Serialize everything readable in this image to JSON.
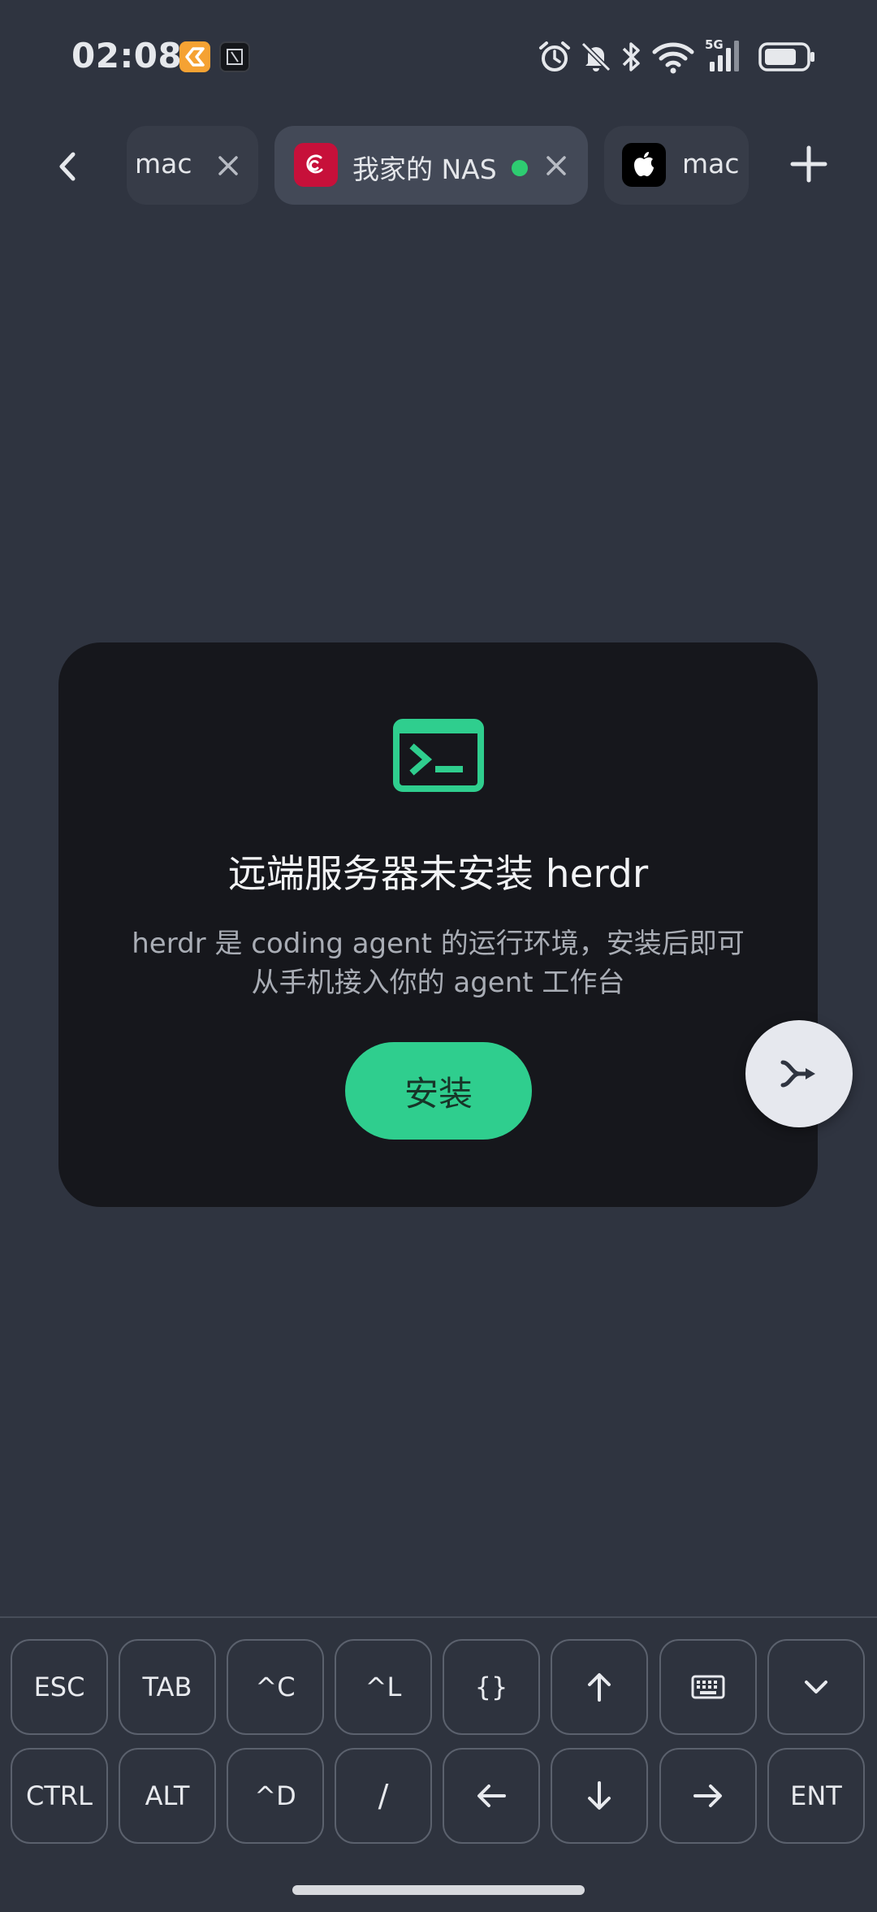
{
  "status_bar": {
    "time": "02:08",
    "network": "5G",
    "icons": [
      "alarm-icon",
      "bell-off-icon",
      "bluetooth-icon",
      "wifi-icon",
      "cell-signal-icon",
      "battery-icon"
    ]
  },
  "tabs": [
    {
      "label": "mac",
      "icon": "none",
      "active": false
    },
    {
      "label": "我家的 NAS",
      "icon": "debian-icon",
      "active": true,
      "status_color": "#2ecc71"
    },
    {
      "label": "mac",
      "icon": "apple-icon",
      "active": false
    }
  ],
  "card": {
    "icon": "terminal-icon",
    "title": "远端服务器未安装 herdr",
    "description_line1": "herdr 是 coding agent 的运行环境，安装后即可",
    "description_line2": "从手机接入你的 agent 工作台",
    "install_label": "安装",
    "accent_color": "#2fce8e"
  },
  "fab": {
    "icon": "branch-send-icon"
  },
  "keys": {
    "row1": [
      "ESC",
      "TAB",
      "^C",
      "^L",
      "{}",
      "↑",
      "keyboard-icon",
      "chevron-down-icon"
    ],
    "row2": [
      "CTRL",
      "ALT",
      "^D",
      "/",
      "←",
      "↓",
      "→",
      "ENT"
    ]
  },
  "colors": {
    "background": "#2f3440",
    "card": "#16171c",
    "accent": "#2fce8e",
    "online": "#2ecc71",
    "debian": "#c7103a"
  }
}
